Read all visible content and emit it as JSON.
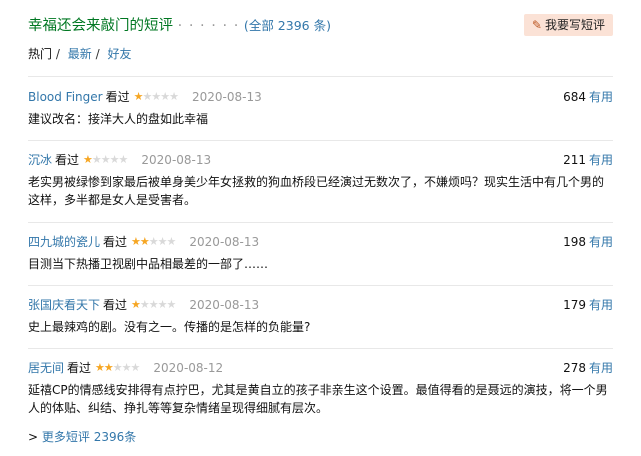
{
  "header": {
    "title": "幸福还会来敲门的短评",
    "dots": "· · · · · ·",
    "count_open": "(",
    "count_link": "全部 2396 条",
    "count_close": ")",
    "write_button": "我要写短评",
    "write_icon": "pen-icon"
  },
  "tabs": {
    "hot": "热门",
    "latest": "最新",
    "friends": "好友",
    "separator": "/"
  },
  "reviews": [
    {
      "user": "Blood Finger",
      "watched": "看过",
      "rating": 1,
      "date": "2020-08-13",
      "useful_count": "684",
      "useful_label": "有用",
      "content": "建议改名：接洋大人的盘如此幸福"
    },
    {
      "user": "沉冰",
      "watched": "看过",
      "rating": 1,
      "date": "2020-08-13",
      "useful_count": "211",
      "useful_label": "有用",
      "content": "老实男被绿惨到家最后被单身美少年女拯救的狗血桥段已经演过无数次了，不嫌烦吗？现实生活中有几个男的这样，多半都是女人是受害者。"
    },
    {
      "user": "四九城的瓷儿",
      "watched": "看过",
      "rating": 2,
      "date": "2020-08-13",
      "useful_count": "198",
      "useful_label": "有用",
      "content": "目测当下热播卫视剧中品相最差的一部了……"
    },
    {
      "user": "张国庆看天下",
      "watched": "看过",
      "rating": 1,
      "date": "2020-08-13",
      "useful_count": "179",
      "useful_label": "有用",
      "content": "史上最辣鸡的剧。没有之一。传播的是怎样的负能量?"
    },
    {
      "user": "居无间",
      "watched": "看过",
      "rating": 2,
      "date": "2020-08-12",
      "useful_count": "278",
      "useful_label": "有用",
      "content": "延禧CP的情感线安排得有点拧巴，尤其是黄自立的孩子非亲生这个设置。最值得看的是聂远的演技，将一个男人的体贴、纠结、挣扎等等复杂情绪呈现得细腻有层次。"
    }
  ],
  "more": {
    "prefix": ">",
    "label": "更多短评 2396条"
  },
  "colors": {
    "title_green": "#007722",
    "link_blue": "#3377aa",
    "star_on": "#f6a623",
    "star_off": "#d9d9d9",
    "button_bg": "#fbe2d6"
  }
}
